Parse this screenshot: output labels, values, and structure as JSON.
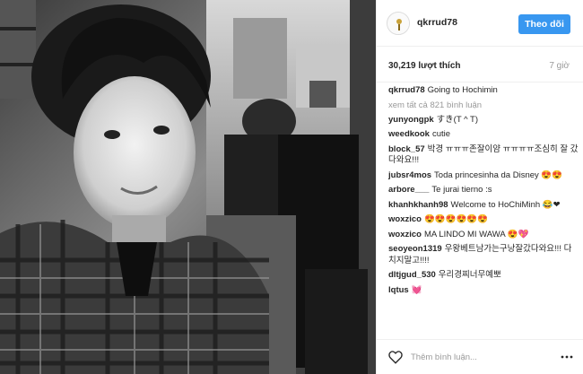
{
  "post": {
    "username": "qkrrud78",
    "follow_label": "Theo dõi",
    "likes": "30,219 lượt thích",
    "time_ago": "7 giờ",
    "caption_user": "qkrrud78",
    "caption_text": "Going to Hochimin",
    "view_all": "xem tất cả 821 bình luận"
  },
  "comments": [
    {
      "user": "yunyongpk",
      "text": "すき(T ^ T)"
    },
    {
      "user": "weedkook",
      "text": "cutie"
    },
    {
      "user": "block_57",
      "text": "박경 ㅠㅠㅠ존잘이얌 ㅠㅠㅠㅠ조심히 잘 갔다와요!!!"
    },
    {
      "user": "jubsr4mos",
      "text": "Toda princesinha da Disney 😍😍"
    },
    {
      "user": "arbore___",
      "text": "Te jurai tierno :s"
    },
    {
      "user": "khanhkhanh98",
      "text": "Welcome to HoChiMinh 😂❤"
    },
    {
      "user": "woxzico",
      "text": "😍😍😍😍😍😍"
    },
    {
      "user": "woxzico",
      "text": "MA LINDO MI WAWA 😍💖"
    },
    {
      "user": "seoyeon1319",
      "text": "우왕베트남가는구낭잘갔다와요!!! 다치지말고!!!!"
    },
    {
      "user": "dltjgud_530",
      "text": "우리경찌너무예뽀"
    },
    {
      "user": "lqtus",
      "text": "💓"
    }
  ],
  "add_comment": {
    "placeholder": "Thêm bình luận..."
  },
  "colors": {
    "follow_button": "#3897f0",
    "muted_text": "#999999",
    "border": "#efefef"
  },
  "icons": [
    "heart-icon",
    "more-icon",
    "avatar"
  ]
}
